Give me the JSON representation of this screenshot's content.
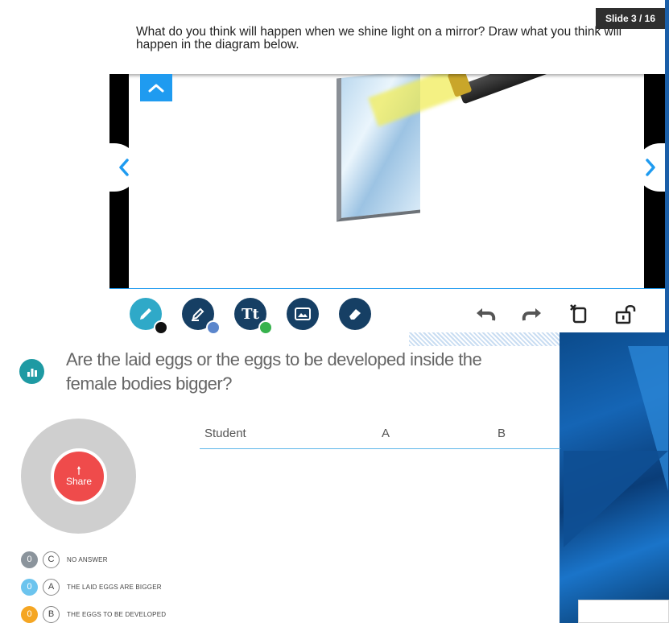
{
  "slide": {
    "question": "What do you think will happen when we shine light on a mirror? Draw what you think will happen in the diagram below.",
    "counter": "Slide 3 / 16"
  },
  "toolbar": {
    "tools": [
      "pencil-icon",
      "marker-icon",
      "text-icon",
      "image-icon",
      "eraser-icon"
    ],
    "tool_text_label": "Tt",
    "actions": [
      "undo-icon",
      "redo-icon",
      "clear-icon",
      "unlock-icon"
    ],
    "accent": "#1f9bf0",
    "dot_colors": [
      "#111111",
      "#5b86cc",
      "#37b24d"
    ]
  },
  "poll": {
    "question": "Are the laid eggs or the eggs to be developed inside the female bodies bigger?",
    "share_label": "Share",
    "columns": [
      "Student",
      "A",
      "B"
    ],
    "answers": [
      {
        "count": "0",
        "letter": "C",
        "text": "NO ANSWER",
        "color": "#8b949c"
      },
      {
        "count": "0",
        "letter": "A",
        "text": "THE LAID EGGS ARE BIGGER",
        "color": "#6cc4ee"
      },
      {
        "count": "0",
        "letter": "B",
        "text": "THE EGGS TO BE DEVELOPED",
        "color": "#f5a623"
      }
    ]
  }
}
